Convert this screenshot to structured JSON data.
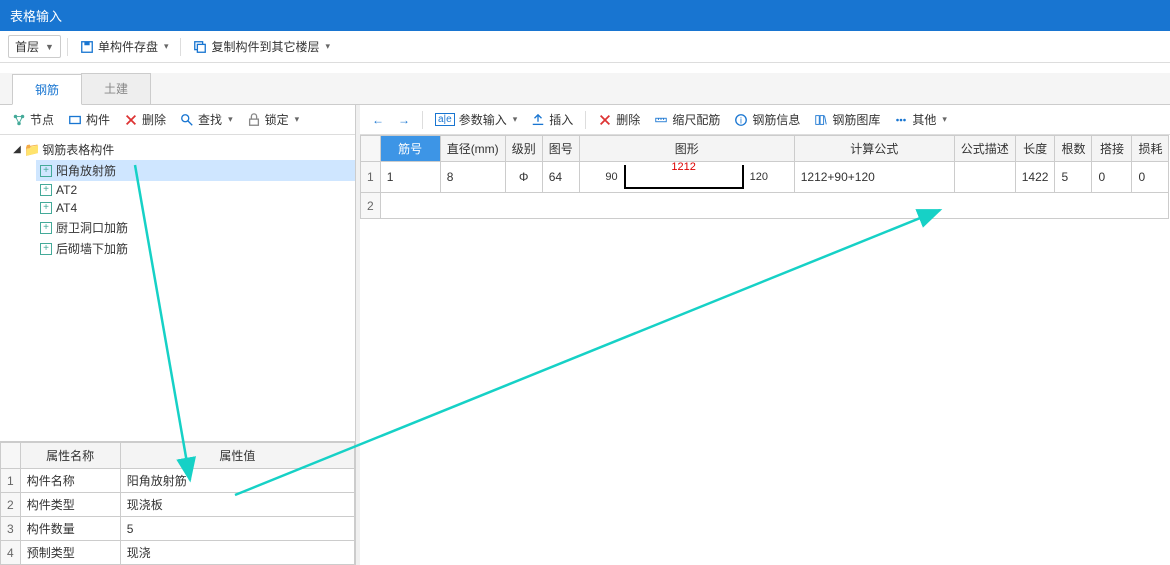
{
  "titlebar": "表格输入",
  "main_toolbar": {
    "floor_select": "首层",
    "save_component": "单构件存盘",
    "copy_component": "复制构件到其它楼层"
  },
  "tabs": {
    "rebar": "钢筋",
    "civil": "土建"
  },
  "left_toolbar": {
    "node": "节点",
    "component": "构件",
    "delete": "删除",
    "find": "查找",
    "lock": "锁定"
  },
  "tree": {
    "root": "钢筋表格构件",
    "items": [
      {
        "label": "阳角放射筋",
        "selected": true
      },
      {
        "label": "AT2"
      },
      {
        "label": "AT4"
      },
      {
        "label": "厨卫洞口加筋"
      },
      {
        "label": "后砌墙下加筋"
      }
    ]
  },
  "props": {
    "header_name": "属性名称",
    "header_value": "属性值",
    "rows": [
      {
        "n": 1,
        "name": "构件名称",
        "value": "阳角放射筋"
      },
      {
        "n": 2,
        "name": "构件类型",
        "value": "现浇板"
      },
      {
        "n": 3,
        "name": "构件数量",
        "value": "5"
      },
      {
        "n": 4,
        "name": "预制类型",
        "value": "现浇"
      }
    ]
  },
  "right_toolbar": {
    "param_input": "参数输入",
    "insert": "插入",
    "delete": "删除",
    "scale": "缩尺配筋",
    "rebar_info": "钢筋信息",
    "rebar_lib": "钢筋图库",
    "other": "其他"
  },
  "grid": {
    "headers": {
      "num": "筋号",
      "diameter": "直径(mm)",
      "grade": "级别",
      "shape_no": "图号",
      "shape": "图形",
      "formula": "计算公式",
      "formula_desc": "公式描述",
      "length": "长度",
      "count": "根数",
      "lap": "搭接",
      "loss": "损耗"
    },
    "rows": [
      {
        "n": 1,
        "num": "1",
        "diameter": "8",
        "grade": "Φ",
        "shape_no": "64",
        "shape": {
          "left": "90",
          "mid": "1212",
          "right": "120"
        },
        "formula": "1212+90+120",
        "formula_desc": "",
        "length": "1422",
        "count": "5",
        "lap": "0",
        "loss": "0"
      },
      {
        "n": 2
      }
    ]
  }
}
